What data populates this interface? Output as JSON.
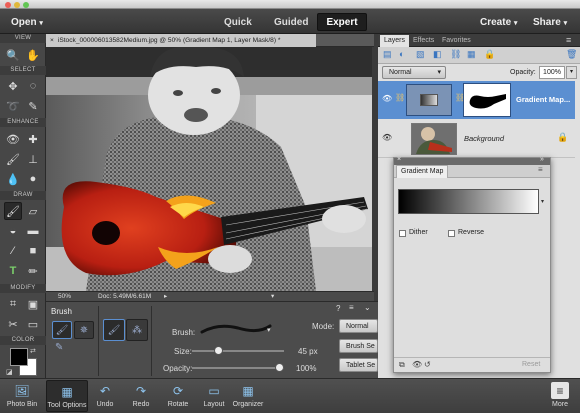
{
  "menu": {
    "open": "Open",
    "create": "Create",
    "share": "Share"
  },
  "modes": {
    "quick": "Quick",
    "guided": "Guided",
    "expert": "Expert"
  },
  "toolbox": {
    "sections": [
      "VIEW",
      "SELECT",
      "ENHANCE",
      "DRAW",
      "MODIFY",
      "COLOR"
    ]
  },
  "document": {
    "tab_title": "iStock_000006013582Medium.jpg @ 50% (Gradient Map 1, Layer Mask/8) *"
  },
  "status": {
    "zoom": "50%",
    "doc": "Doc: 5.49M/6.61M"
  },
  "tool_options": {
    "tool_name": "Brush",
    "brush_label": "Brush:",
    "size_label": "Size:",
    "size_value": "45 px",
    "size_fraction": 0.27,
    "opacity_label": "Opacity:",
    "opacity_value": "100%",
    "opacity_fraction": 1.0,
    "mode_label": "Mode:",
    "mode_value": "Normal",
    "brush_settings": "Brush Se",
    "tablet_settings": "Tablet Se"
  },
  "panel": {
    "tabs": [
      "Layers",
      "Effects",
      "Favorites"
    ],
    "blend_mode": "Normal",
    "opacity_label": "Opacity:",
    "opacity_value": "100%",
    "layers": [
      {
        "name": "Gradient Map..."
      },
      {
        "name": "Background"
      }
    ]
  },
  "gradient_dialog": {
    "tab": "Gradient Map",
    "dither": "Dither",
    "reverse": "Reverse",
    "reset": "Reset"
  },
  "bottombar": {
    "items": [
      "Photo Bin",
      "Tool Options",
      "Undo",
      "Redo",
      "Rotate",
      "Layout",
      "Organizer"
    ],
    "more": "More"
  },
  "colors": {
    "accent_selected": "#5b8fd1",
    "menu_bg": "#3f3f3f",
    "panel_bg": "#e0e0e0",
    "expert_bg": "#1e1e1e"
  }
}
